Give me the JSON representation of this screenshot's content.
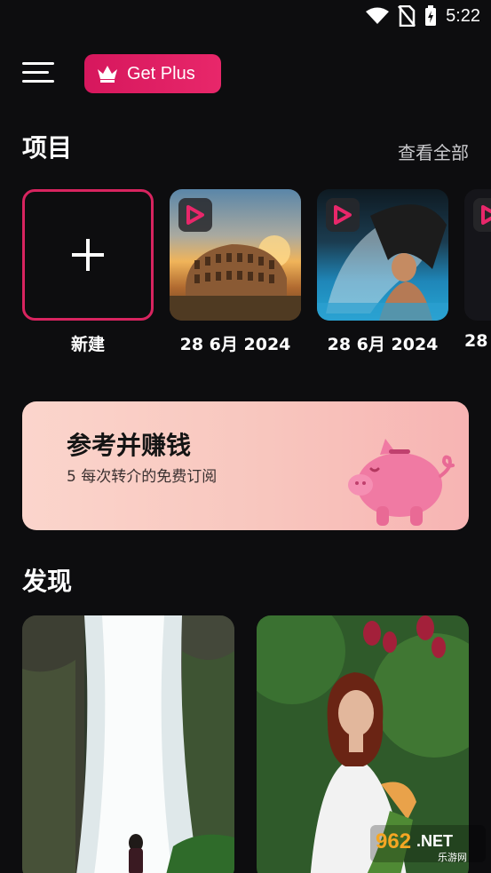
{
  "status_bar": {
    "time": "5:22",
    "icons": [
      "wifi-icon",
      "no-sim-icon",
      "battery-charging-icon"
    ]
  },
  "header": {
    "menu_icon": "hamburger-icon",
    "plus_button": {
      "label": "Get Plus",
      "icon": "crown-icon",
      "color": "#e01f63"
    }
  },
  "projects": {
    "title": "项目",
    "see_all": "查看全部",
    "items": [
      {
        "caption": "新建",
        "type": "new"
      },
      {
        "caption": "28 6月 2024",
        "type": "video",
        "scene": "colosseum"
      },
      {
        "caption": "28 6月 2024",
        "type": "video",
        "scene": "hair-flip-pool"
      },
      {
        "caption": "28",
        "type": "video",
        "scene": "partial"
      }
    ]
  },
  "referral": {
    "title": "参考并赚钱",
    "subtitle": "5 每次转介的免费订阅",
    "icon": "piggy-bank-icon"
  },
  "discover": {
    "title": "发现",
    "cards": [
      {
        "scene": "waterfall"
      },
      {
        "scene": "portrait-flowers"
      }
    ]
  },
  "watermark": {
    "text": "962.NET",
    "sub": "乐游网"
  },
  "accent_color": "#d8245f"
}
